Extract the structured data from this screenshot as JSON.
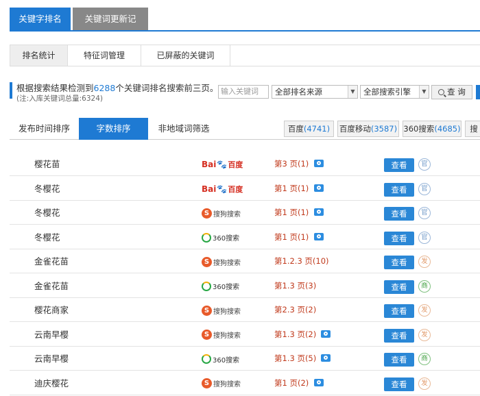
{
  "top_tabs": [
    {
      "label": "关键字排名",
      "active": true
    },
    {
      "label": "关键词更新记录",
      "active": false
    }
  ],
  "sub_tabs": [
    {
      "label": "排名统计",
      "active": true
    },
    {
      "label": "特征词管理",
      "active": false
    },
    {
      "label": "已屏蔽的关键词",
      "active": false
    }
  ],
  "info": {
    "prefix": "根据搜索结果检测到",
    "count": "6288",
    "suffix": "个关键词排名搜索前三页。",
    "note": "(注:入库关键词总量:6324)"
  },
  "search": {
    "placeholder": "输入关键词",
    "source_select": "全部排名来源",
    "engine_select": "全部搜索引擎",
    "query_label": "查 询"
  },
  "sort_tabs": [
    {
      "label": "发布时间排序",
      "active": false
    },
    {
      "label": "字数排序",
      "active": true
    },
    {
      "label": "非地域词筛选",
      "active": false
    }
  ],
  "engines": [
    {
      "name": "百度",
      "count": "(4741)"
    },
    {
      "name": "百度移动",
      "count": "(3587)"
    },
    {
      "name": "360搜索",
      "count": "(4685)"
    },
    {
      "name": "搜",
      "count": ""
    }
  ],
  "logos": {
    "baidu_a": "Bai",
    "baidu_paw": "🐾",
    "baidu_b": "百度",
    "sogou_s": "S",
    "sogou_text": "搜狗搜索",
    "so360_text": "360搜索"
  },
  "view_label": "查看",
  "rows": [
    {
      "keyword": "樱花苗",
      "engine": "baidu",
      "rank": "第3 页(1)",
      "camera": true,
      "badge": "官",
      "badge_type": "guan"
    },
    {
      "keyword": "冬樱花",
      "engine": "baidu",
      "rank": "第1 页(1)",
      "camera": true,
      "badge": "官",
      "badge_type": "guan"
    },
    {
      "keyword": "冬樱花",
      "engine": "sogou",
      "rank": "第1 页(1)",
      "camera": true,
      "badge": "官",
      "badge_type": "guan"
    },
    {
      "keyword": "冬樱花",
      "engine": "so360",
      "rank": "第1 页(1)",
      "camera": true,
      "badge": "官",
      "badge_type": "guan"
    },
    {
      "keyword": "金雀花苗",
      "engine": "sogou",
      "rank": "第1.2.3 页(10)",
      "camera": false,
      "badge": "发",
      "badge_type": "fa"
    },
    {
      "keyword": "金雀花苗",
      "engine": "so360",
      "rank": "第1.3 页(3)",
      "camera": false,
      "badge": "商",
      "badge_type": "shang"
    },
    {
      "keyword": "樱花商家",
      "engine": "sogou",
      "rank": "第2.3 页(2)",
      "camera": false,
      "badge": "发",
      "badge_type": "fa"
    },
    {
      "keyword": "云南早樱",
      "engine": "sogou",
      "rank": "第1.3 页(2)",
      "camera": true,
      "badge": "发",
      "badge_type": "fa"
    },
    {
      "keyword": "云南早樱",
      "engine": "so360",
      "rank": "第1.3 页(5)",
      "camera": true,
      "badge": "商",
      "badge_type": "shang"
    },
    {
      "keyword": "迪庆樱花",
      "engine": "sogou",
      "rank": "第1 页(2)",
      "camera": true,
      "badge": "发",
      "badge_type": "fa"
    }
  ]
}
